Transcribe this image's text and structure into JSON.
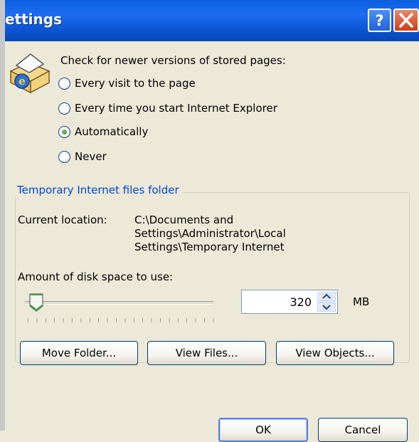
{
  "window": {
    "title": "ettings",
    "help_label": "?",
    "close_icon": "close-x-icon"
  },
  "cache_check": {
    "heading": "Check for newer versions of stored pages:",
    "options": [
      {
        "label": "Every visit to the page",
        "selected": false
      },
      {
        "label": "Every time you start Internet Explorer",
        "selected": false
      },
      {
        "label": "Automatically",
        "selected": true
      },
      {
        "label": "Never",
        "selected": false
      }
    ]
  },
  "temp_files": {
    "group_title": "Temporary Internet files folder",
    "location_label": "Current location:",
    "location_lines": [
      "C:\\Documents and",
      "Settings\\Administrator\\Local",
      "Settings\\Temporary Internet"
    ],
    "disk_label": "Amount of disk space to use:",
    "disk_value": "320",
    "disk_unit": "MB",
    "move_button": "Move Folder...",
    "view_files_button": "View Files...",
    "view_objects_button": "View Objects..."
  },
  "footer": {
    "ok": "OK",
    "cancel": "Cancel"
  },
  "colors": {
    "titlebar": "#0a5fe0",
    "group_title": "#0046d5",
    "dialog_bg": "#ece9d8"
  }
}
